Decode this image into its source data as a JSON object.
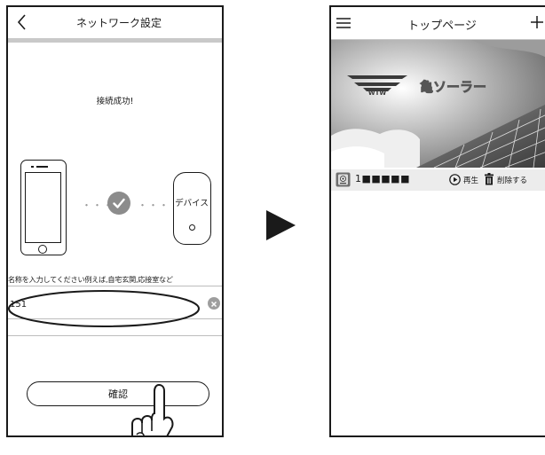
{
  "left_screen": {
    "header": {
      "back_icon": "chevron-left-icon",
      "title": "ネットワーク設定"
    },
    "success_message": "接続成功!",
    "connection": {
      "phone_icon": "smartphone-icon",
      "check_icon": "check-circle-icon",
      "separator": "・・・",
      "device_label": "デバイス"
    },
    "name_hint": "名称を入力してください例えば,自宅玄関,応接室など",
    "name_input": {
      "value": "151",
      "clear_icon": "clear-circle-icon"
    },
    "confirm_button": "確認",
    "hand_icon": "pointing-hand-icon"
  },
  "transition": {
    "arrow_icon": "play-arrow-icon"
  },
  "right_screen": {
    "header": {
      "menu_icon": "hamburger-menu-icon",
      "title": "トップページ",
      "add_icon": "plus-icon"
    },
    "banner": {
      "logo_text": "WTW",
      "banner_text": "亀ソーラー"
    },
    "device_row": {
      "camera_icon": "camera-icon",
      "device_name": "1■■■■■",
      "play_label": "再生",
      "delete_label": "削除する"
    }
  },
  "colors": {
    "line": "#c9c9c9",
    "check": "#8c8c8c",
    "row_bg": "#ececec"
  }
}
